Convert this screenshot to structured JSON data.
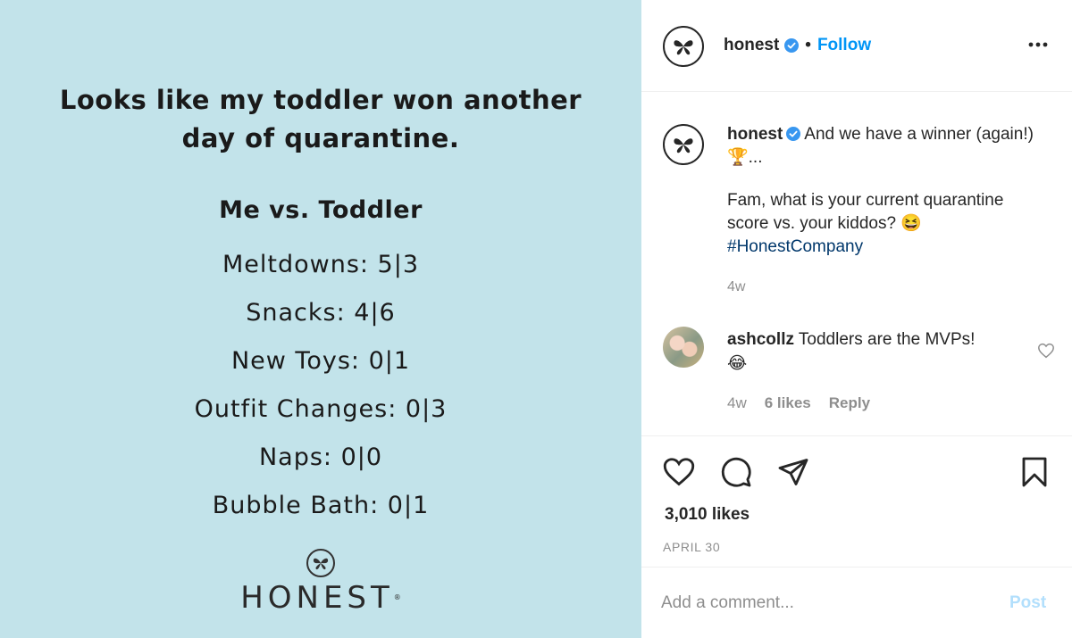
{
  "image": {
    "headline": "Looks like my toddler won another day of quarantine.",
    "subhead": "Me vs. Toddler",
    "scores": [
      "Meltdowns: 5|3",
      "Snacks: 4|6",
      "New Toys: 0|1",
      "Outfit Changes: 0|3",
      "Naps: 0|0",
      "Bubble Bath: 0|1"
    ],
    "brand": "HONEST",
    "brand_mark": "®",
    "background_color": "#c2e3ea"
  },
  "header": {
    "username": "honest",
    "separator": "•",
    "follow_label": "Follow",
    "more_label": "•••"
  },
  "caption": {
    "username": "honest",
    "line1": "And we have a winner (again!) 🏆...",
    "line2": "Fam, what is your current quarantine score vs. your kiddos? 😆",
    "hashtag": "#HonestCompany",
    "time": "4w"
  },
  "comment": {
    "username": "ashcollz",
    "text": "Toddlers are the MVPs!",
    "emoji": "😂",
    "time": "4w",
    "likes": "6 likes",
    "reply_label": "Reply"
  },
  "actions": {
    "likes": "3,010 likes",
    "date": "APRIL 30"
  },
  "comment_box": {
    "placeholder": "Add a comment...",
    "post_label": "Post"
  },
  "colors": {
    "accent": "#0095f6",
    "hashtag": "#00376b",
    "muted": "#8e8e8e",
    "post_disabled": "#b2dffc"
  }
}
